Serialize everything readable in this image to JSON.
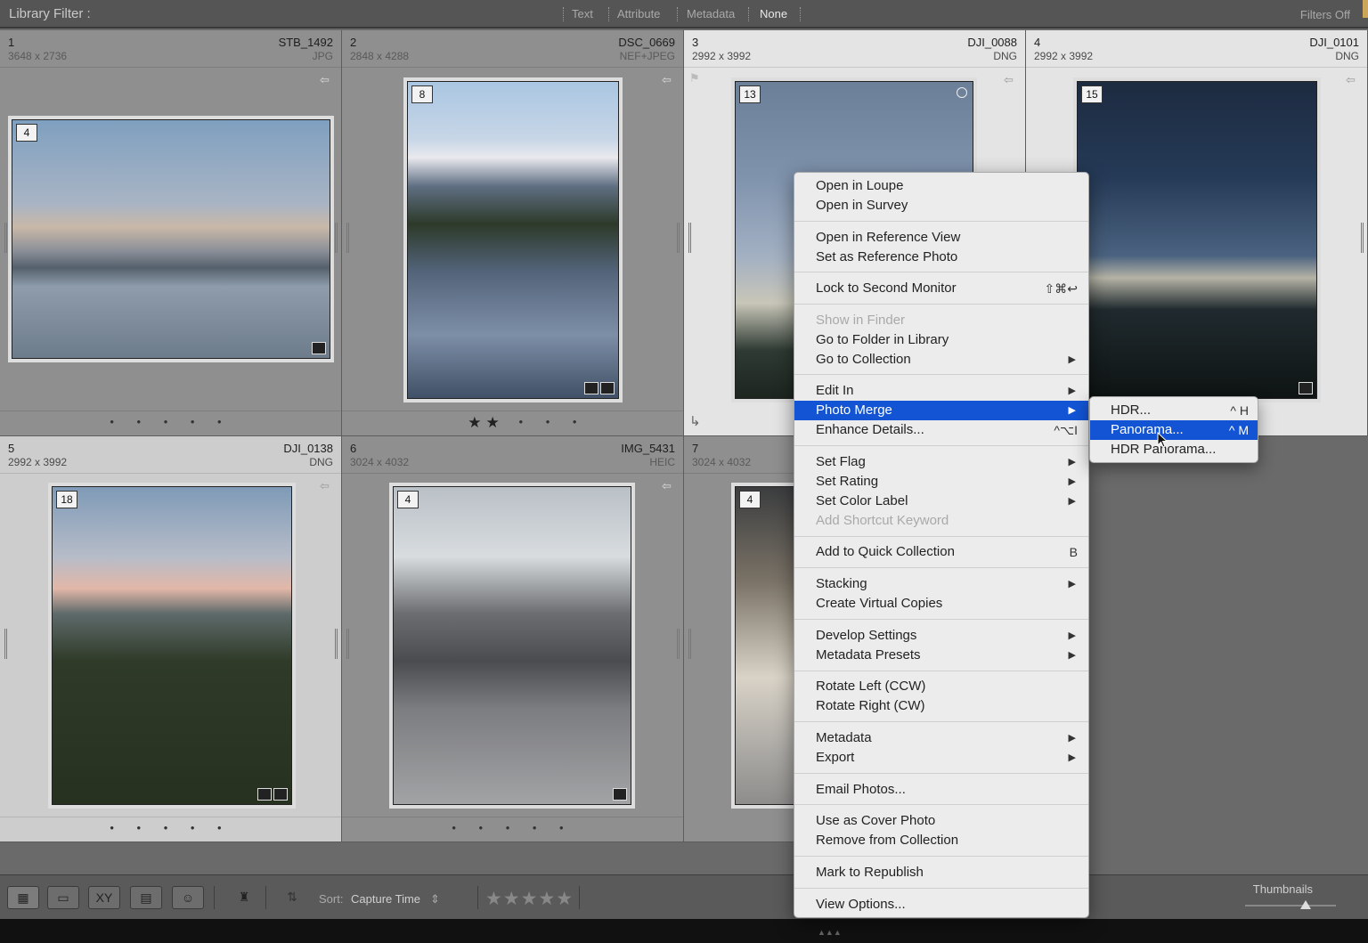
{
  "filter_bar": {
    "title": "Library Filter :",
    "options": [
      "Text",
      "Attribute",
      "Metadata",
      "None"
    ],
    "active_option": "None",
    "filters_state": "Filters Off"
  },
  "photos": [
    {
      "index": "1",
      "filename": "STB_1492",
      "dimensions": "3648 x 2736",
      "format": "JPG",
      "badge": "4",
      "rating_dots": "• • • • •"
    },
    {
      "index": "2",
      "filename": "DSC_0669",
      "dimensions": "2848 x 4288",
      "format": "NEF+JPEG",
      "badge": "8",
      "stars": "★★",
      "rating_dots": "• • •"
    },
    {
      "index": "3",
      "filename": "DJI_0088",
      "dimensions": "2992 x 3992",
      "format": "DNG",
      "badge": "13"
    },
    {
      "index": "4",
      "filename": "DJI_0101",
      "dimensions": "2992 x 3992",
      "format": "DNG",
      "badge": "15"
    },
    {
      "index": "5",
      "filename": "DJI_0138",
      "dimensions": "2992 x 3992",
      "format": "DNG",
      "badge": "18",
      "rating_dots": "• • • • •"
    },
    {
      "index": "6",
      "filename": "IMG_5431",
      "dimensions": "3024 x 4032",
      "format": "HEIC",
      "badge": "4",
      "rating_dots": "• • • • •"
    },
    {
      "index": "7",
      "filename": "",
      "dimensions": "3024 x 4032",
      "format": "",
      "badge": "4"
    }
  ],
  "context_menu": {
    "items": [
      {
        "label": "Open in Loupe"
      },
      {
        "label": "Open in Survey"
      },
      {
        "label": "Open in Reference View"
      },
      {
        "label": "Set as Reference Photo"
      },
      {
        "label": "Lock to Second Monitor",
        "shortcut": "⇧⌘↩"
      },
      {
        "label": "Show in Finder",
        "disabled": true
      },
      {
        "label": "Go to Folder in Library"
      },
      {
        "label": "Go to Collection",
        "submenu": true
      },
      {
        "label": "Edit In",
        "submenu": true
      },
      {
        "label": "Photo Merge",
        "submenu": true,
        "selected": true
      },
      {
        "label": "Enhance Details...",
        "shortcut": "^⌥I"
      },
      {
        "label": "Set Flag",
        "submenu": true
      },
      {
        "label": "Set Rating",
        "submenu": true
      },
      {
        "label": "Set Color Label",
        "submenu": true
      },
      {
        "label": "Add Shortcut Keyword",
        "disabled": true
      },
      {
        "label": "Add to Quick Collection",
        "shortcut": "B"
      },
      {
        "label": "Stacking",
        "submenu": true
      },
      {
        "label": "Create Virtual Copies"
      },
      {
        "label": "Develop Settings",
        "submenu": true
      },
      {
        "label": "Metadata Presets",
        "submenu": true
      },
      {
        "label": "Rotate Left (CCW)"
      },
      {
        "label": "Rotate Right (CW)"
      },
      {
        "label": "Metadata",
        "submenu": true
      },
      {
        "label": "Export",
        "submenu": true
      },
      {
        "label": "Email Photos..."
      },
      {
        "label": "Use as Cover Photo"
      },
      {
        "label": "Remove from Collection"
      },
      {
        "label": "Mark to Republish"
      },
      {
        "label": "View Options..."
      }
    ]
  },
  "photo_merge_submenu": {
    "items": [
      {
        "label": "HDR...",
        "shortcut": "^ H"
      },
      {
        "label": "Panorama...",
        "shortcut": "^ M",
        "selected": true
      },
      {
        "label": "HDR Panorama..."
      }
    ]
  },
  "toolbar": {
    "sort_label": "Sort:",
    "sort_value": "Capture Time",
    "stars": "★★★★★",
    "thumbnails_label": "Thumbnails",
    "thumbnail_size": 0.65
  },
  "icons": [
    "grid-view-icon",
    "loupe-view-icon",
    "compare-view-icon",
    "survey-view-icon",
    "people-view-icon",
    "spray-can-icon",
    "sort-direction-icon",
    "flag-icon",
    "rotate-icon",
    "badge-icon"
  ],
  "colors": {
    "selection": "#1254d4",
    "menu_bg": "#ececec",
    "grid_bg": "#8f8f8f"
  }
}
